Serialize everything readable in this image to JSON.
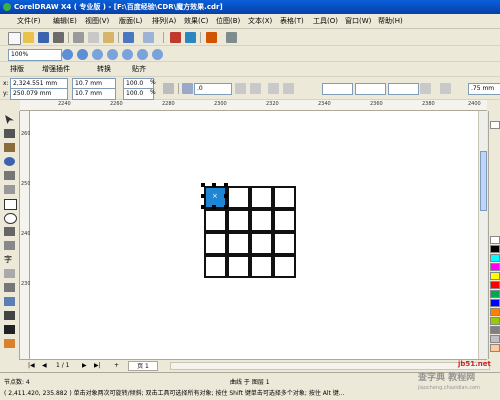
{
  "title": "CorelDRAW X4 ( 专业版 ) - [F:\\百度经验\\CDR\\魔方效果.cdr]",
  "menu": [
    "文件(F)",
    "编辑(E)",
    "视图(V)",
    "版面(L)",
    "排列(A)",
    "效果(C)",
    "位图(B)",
    "文本(X)",
    "表格(T)",
    "工具(O)",
    "窗口(W)",
    "帮助(H)"
  ],
  "zoom": "100%",
  "plugin_bar": [
    "排版",
    "增强插件",
    "转换",
    "贴齐"
  ],
  "props": {
    "x": "2,324.551 mm",
    "y": "250.079 mm",
    "w": "10.7 mm",
    "h": "10.7 mm",
    "scale_x": "100.0",
    "scale_y": "100.0",
    "percent": "%",
    "angle": ".0",
    "outline": ".75 mm"
  },
  "hruler": [
    "2240",
    "2260",
    "2280",
    "2300",
    "2320",
    "2340",
    "2360",
    "2380",
    "2400"
  ],
  "vruler": [
    "260",
    "250",
    "240",
    "230"
  ],
  "page": {
    "count": "1 / 1",
    "tab": "页 1"
  },
  "status": {
    "nodes": "节点数: 4",
    "layer": "曲线 于 图层 1",
    "hint": "( 2,411.420, 235.882 ) 单击对象两次可旋转/倾斜; 双击工具可选择所有对象; 按住 Shift 键单击可选择多个对象; 按住 Alt 键..."
  },
  "watermark": {
    "site": "jb51.net",
    "brand": "查字典 教程网",
    "url": "jiaocheng.chazidian.com"
  },
  "colors": {
    "selected_cell": "#1f86d6",
    "title_bar": "#0a5fd8"
  },
  "palette": [
    "#ffffff",
    "#000000",
    "#00ffff",
    "#ff00ff",
    "#ffff00",
    "#ff0000",
    "#00a651",
    "#0000ff",
    "#ff8000",
    "#99cc00",
    "#808080",
    "#c0c0c0",
    "#ffcc99",
    "#cc6600"
  ]
}
